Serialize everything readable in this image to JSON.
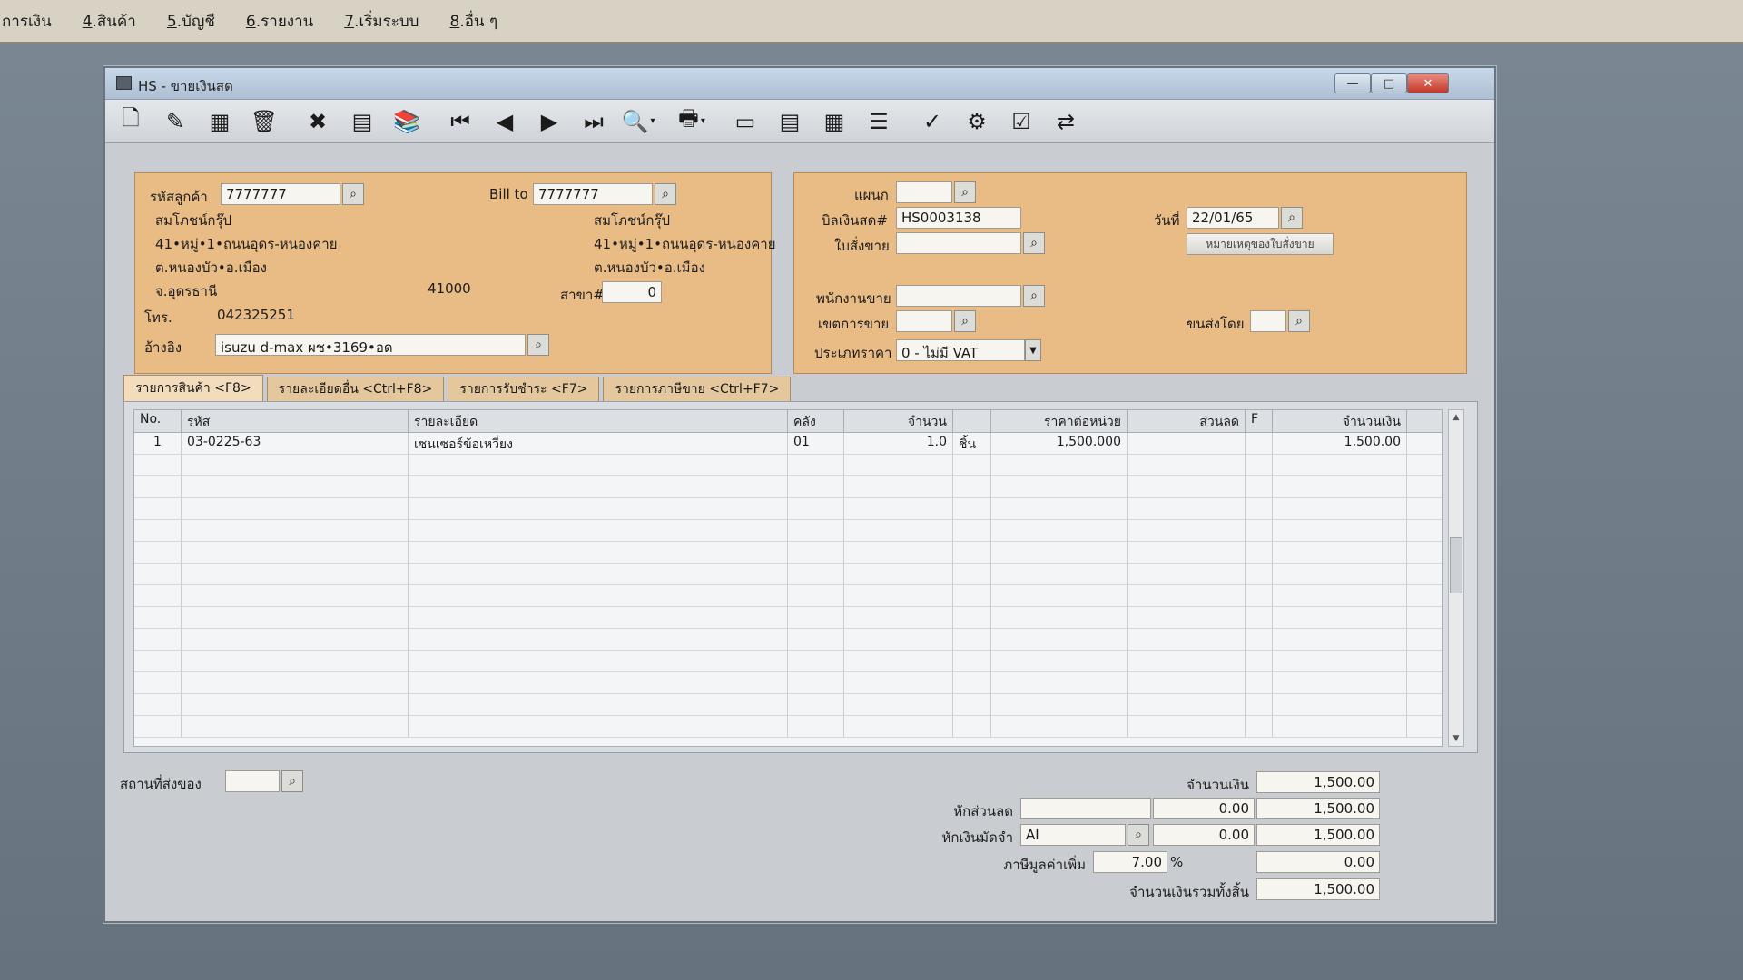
{
  "menubar": {
    "items": [
      {
        "hotkey": "",
        "label": "การเงิน"
      },
      {
        "hotkey": "4",
        "label": ".สินค้า"
      },
      {
        "hotkey": "5",
        "label": ".บัญชี"
      },
      {
        "hotkey": "6",
        "label": ".รายงาน"
      },
      {
        "hotkey": "7",
        "label": ".เริ่มระบบ"
      },
      {
        "hotkey": "8",
        "label": ".อื่น ๆ"
      }
    ]
  },
  "window": {
    "title": "HS - ขายเงินสด",
    "min_glyph": "—",
    "max_glyph": "□",
    "close_glyph": "✕"
  },
  "toolbar": {
    "icons": [
      "new-document-icon",
      "edit-icon",
      "stamp-icon",
      "trash-icon",
      "cancel-icon",
      "save-icon",
      "books-icon",
      "first-record-icon",
      "previous-icon",
      "next-icon",
      "last-record-icon",
      "preview-icon",
      "print-icon",
      "monitor-icon",
      "calculator-icon",
      "spreadsheet-icon",
      "form-icon",
      "approve-icon",
      "tools-icon",
      "confirm-icon",
      "network-icon"
    ],
    "glyphs": [
      "🗋",
      "✎",
      "▦",
      "🗑",
      "✖",
      "▤",
      "📚",
      "⏮",
      "◀",
      "▶",
      "⏭",
      "🔍",
      "🖶",
      "▭",
      "▤",
      "▦",
      "☰",
      "✓",
      "⚙",
      "☑",
      "⇄"
    ]
  },
  "customer": {
    "code_label": "รหัสลูกค้า",
    "code_value": "7777777",
    "billto_label": "Bill to",
    "billto_value": "7777777",
    "name": "สมโภชน์กรุ๊ป",
    "address1": "41•หมู่•1•ถนนอุดร-หนองคาย",
    "address2": "ต.หนองบัว•อ.เมือง",
    "province": "จ.อุดรธานี",
    "zip": "41000",
    "billto_name": "สมโภชน์กรุ๊ป",
    "billto_address1": "41•หมู่•1•ถนนอุดร-หนองคาย",
    "billto_address2": "ต.หนองบัว•อ.เมือง",
    "branch_label": "สาขา#",
    "branch_value": "0",
    "phone_label": "โทร.",
    "phone_value": "042325251",
    "ref_label": "อ้างอิง",
    "ref_value": "isuzu d-max ผช•3169•อด"
  },
  "doc": {
    "dept_label": "แผนก",
    "dept_value": "",
    "bill_label": "บิลเงินสด#",
    "bill_value": "HS0003138",
    "date_label": "วันที่",
    "date_value": "22/01/65",
    "order_label": "ใบสั่งขาย",
    "order_value": "",
    "order_note_button": "หมายเหตุของใบสั่งขาย",
    "salesman_label": "พนักงานขาย",
    "salesman_value": "",
    "area_label": "เขตการขาย",
    "area_value": "",
    "shipby_label": "ขนส่งโดย",
    "shipby_value": "",
    "pricetype_label": "ประเภทราคา",
    "pricetype_value": "0 - ไม่มี VAT"
  },
  "tabs": [
    "รายการสินค้า <F8>",
    "รายละเอียดอื่น <Ctrl+F8>",
    "รายการรับชำระ <F7>",
    "รายการภาษีขาย <Ctrl+F7>"
  ],
  "grid": {
    "headers": [
      "No.",
      "รหัส",
      "รายละเอียด",
      "คลัง",
      "จำนวน",
      "",
      "ราคาต่อหน่วย",
      "ส่วนลด",
      "F",
      "จำนวนเงิน"
    ],
    "rows": [
      {
        "no": "1",
        "code": "03-0225-63",
        "desc": "เซนเซอร์ข้อเหวี่ยง",
        "wh": "01",
        "qty": "1.0",
        "unit": "ชิ้น",
        "price": "1,500.000",
        "disc": "",
        "f": "",
        "amount": "1,500.00"
      }
    ]
  },
  "footer": {
    "shipto_label": "สถานที่ส่งของ",
    "shipto_value": "",
    "amount_label": "จำนวนเงิน",
    "amount_value": "1,500.00",
    "discount_label": "หักส่วนลด",
    "discount_text": "",
    "discount_amount": "0.00",
    "discount_total": "1,500.00",
    "deposit_label": "หักเงินมัดจำ",
    "deposit_code": "AI",
    "deposit_amount": "0.00",
    "deposit_total": "1,500.00",
    "vat_label": "ภาษีมูลค่าเพิ่ม",
    "vat_rate": "7.00",
    "vat_pct": "%",
    "vat_amount": "0.00",
    "grand_label": "จำนวนเงินรวมทั้งสิ้น",
    "grand_value": "1,500.00"
  },
  "colors": {
    "panel": "#e9bc86",
    "accent": "#c2372a"
  }
}
